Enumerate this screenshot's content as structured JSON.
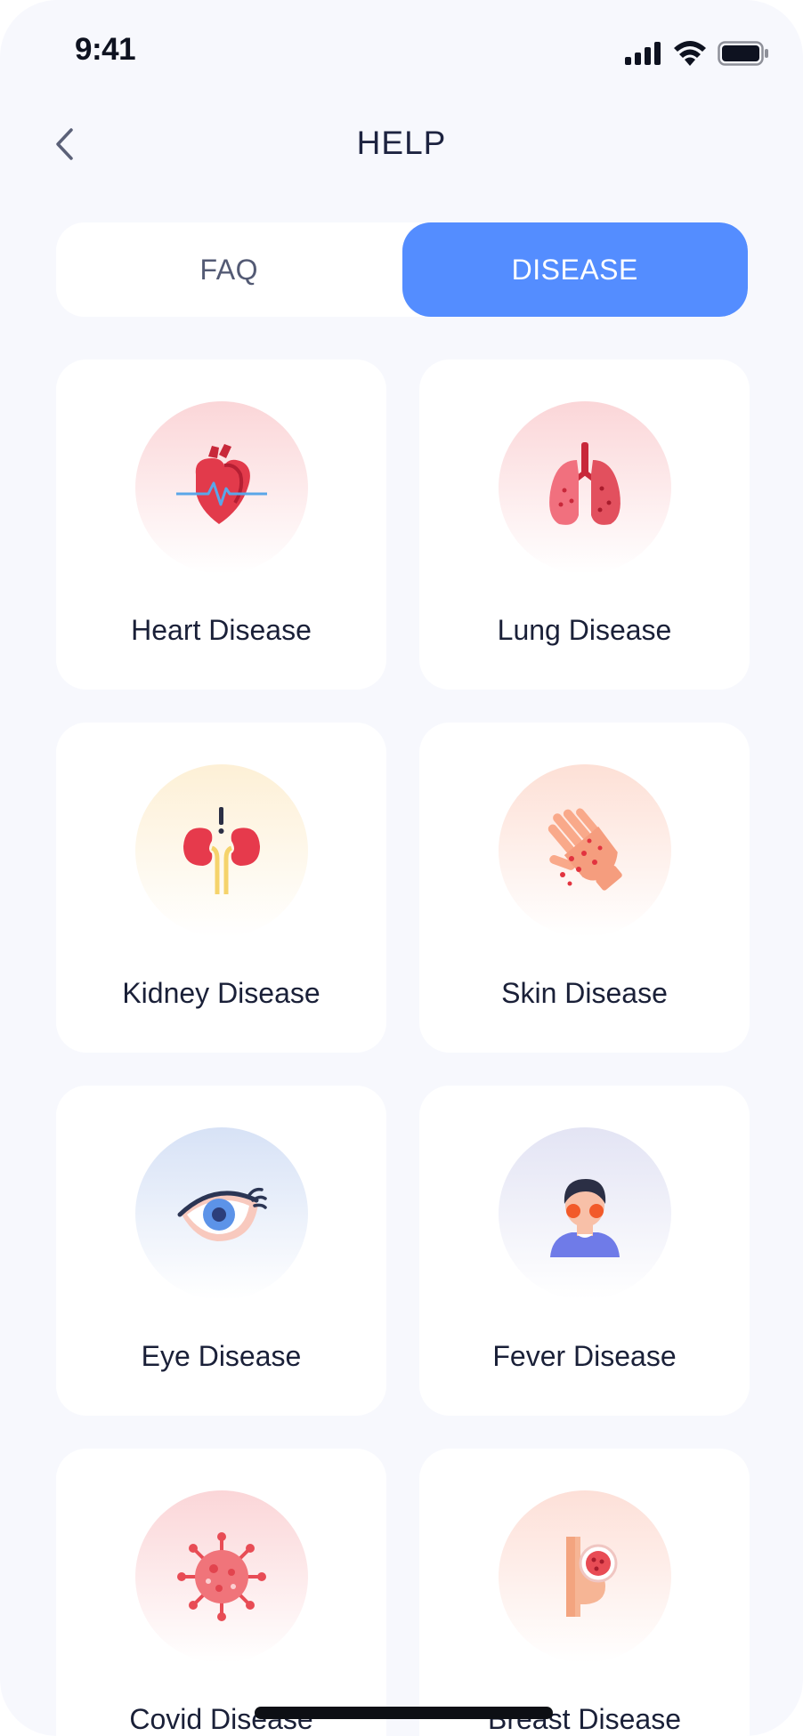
{
  "status": {
    "time": "9:41"
  },
  "header": {
    "title": "HELP",
    "back_icon": "chevron-left-icon"
  },
  "tabs": [
    {
      "label": "FAQ",
      "active": false
    },
    {
      "label": "DISEASE",
      "active": true
    }
  ],
  "colors": {
    "accent": "#548dff",
    "background": "#f7f8fd",
    "card": "#ffffff",
    "text": "#1a2038"
  },
  "diseases": [
    {
      "label": "Heart Disease",
      "icon": "heart-icon"
    },
    {
      "label": "Lung Disease",
      "icon": "lungs-icon"
    },
    {
      "label": "Kidney Disease",
      "icon": "kidney-icon"
    },
    {
      "label": "Skin Disease",
      "icon": "skin-hand-icon"
    },
    {
      "label": "Eye Disease",
      "icon": "eye-icon"
    },
    {
      "label": "Fever Disease",
      "icon": "fever-person-icon"
    },
    {
      "label": "Covid Disease",
      "icon": "virus-icon"
    },
    {
      "label": "Breast Disease",
      "icon": "breast-icon"
    }
  ]
}
